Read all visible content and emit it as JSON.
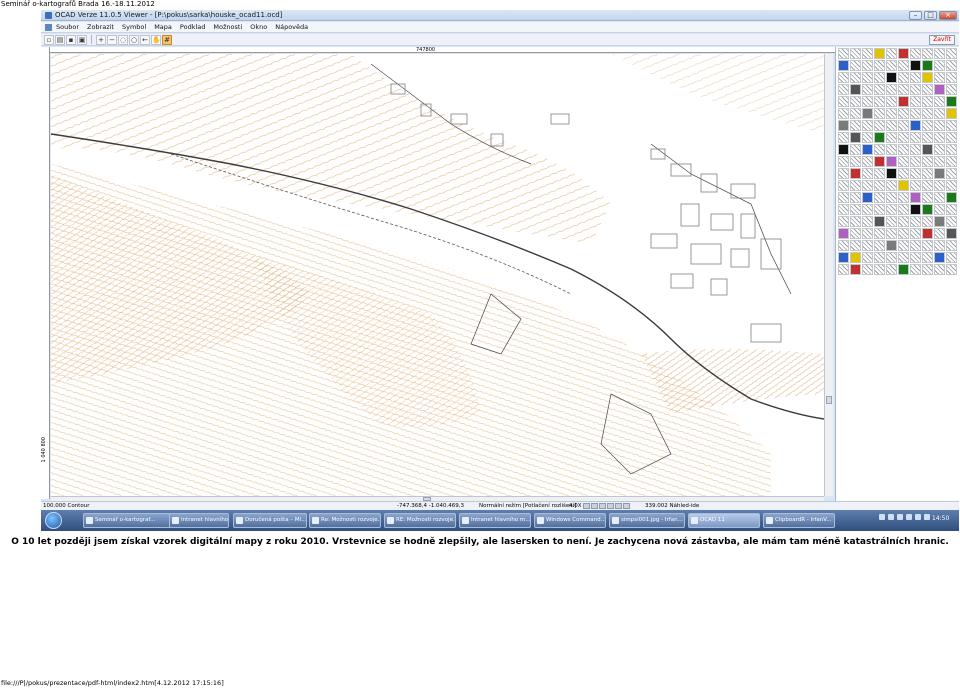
{
  "page": {
    "header": "Seminář o-kartografů Brada 16.-18.11.2012",
    "caption": "O 10 let později jsem získal vzorek digitální mapy z roku 2010. Vrstevnice se hodně zlepšily, ale lasersken to není. Je zachycena nová zástavba, ale mám tam méně katastrálních hranic.",
    "footer": "file:///P|/pokus/prezentace/pdf-html/index2.htm[4.12.2012 17:15:16]"
  },
  "window": {
    "title": "OCAD Verze 11.0.5 Viewer - [P:\\pokus\\sarka\\houske_ocad11.ocd]",
    "controls": [
      "–",
      "□",
      "×"
    ]
  },
  "menu": {
    "items": [
      "Soubor",
      "Zobrazit",
      "Symbol",
      "Mapa",
      "Podklad",
      "Možnosti",
      "Okno",
      "Nápověda"
    ]
  },
  "toolbar": {
    "close_label": "Zavřít",
    "tools": [
      "new-icon",
      "open-icon",
      "save-icon",
      "print-icon",
      "zoom-in-icon",
      "zoom-out-icon",
      "zoom-window-icon",
      "zoom-fit-icon",
      "back-icon",
      "hand-icon",
      "grid-icon"
    ]
  },
  "ruler": {
    "top_label": "747800",
    "left_label": "1 040 800"
  },
  "status": {
    "scale": "100.000 Contour",
    "coords": "-747.368,4 -1.040.469,3",
    "mode": "Normální režim [Potlačení rozlišení]",
    "zoom_pct": "4.0X",
    "zoom_label": "339.002 Náhled-ide"
  },
  "taskbar": {
    "tasks": [
      {
        "label": "Seminář o-kartograf...",
        "active": false
      },
      {
        "label": "Intranet hlavního m...",
        "active": false
      },
      {
        "label": "Doručená pošta – Mi...",
        "active": false
      },
      {
        "label": "Re: Možnosti rozvoje...",
        "active": false
      },
      {
        "label": "RE: Možnosti rozvoje...",
        "active": false
      },
      {
        "label": "Intranet hlavního m...",
        "active": false
      },
      {
        "label": "Windows Command...",
        "active": false
      },
      {
        "label": "simpsi001.jpg - Irfan...",
        "active": false
      },
      {
        "label": "OCAD 11",
        "active": true
      },
      {
        "label": "ClipboardR - IrfanV...",
        "active": false
      }
    ],
    "clock": "14:50"
  },
  "colors": {
    "contour": "#d9a15c",
    "road": "#3c3c3c",
    "building": "#8c8c8c",
    "taskbar": "#2f4e7d"
  }
}
